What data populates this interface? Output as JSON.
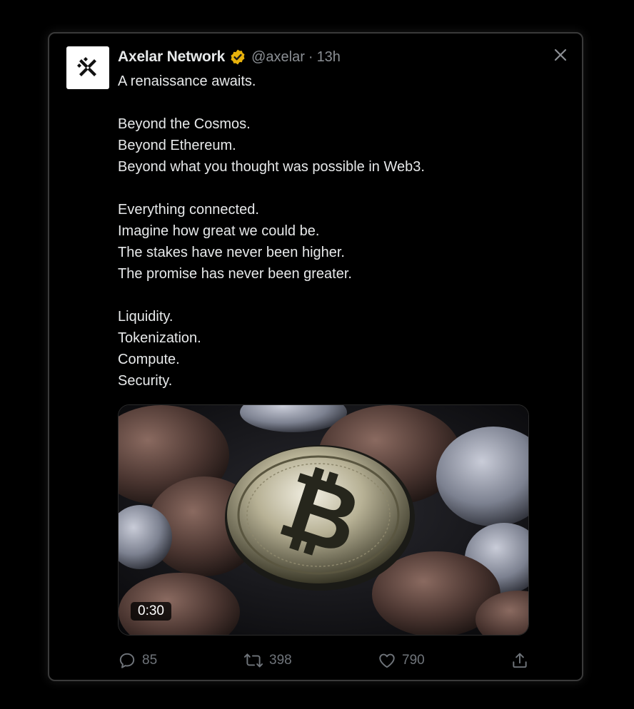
{
  "tweet": {
    "author_name": "Axelar Network",
    "handle": "@axelar",
    "separator": "·",
    "time": "13h",
    "verified_icon": "verified-badge-icon",
    "body_lines": [
      "A renaissance awaits.",
      "",
      "Beyond the Cosmos.",
      "Beyond Ethereum.",
      "Beyond what you thought was possible in Web3.",
      "",
      "Everything connected.",
      "Imagine how great we could be.",
      "The stakes have never been higher.",
      "The promise has never been greater.",
      "",
      "Liquidity.",
      "Tokenization.",
      "Compute.",
      "Security."
    ],
    "video": {
      "duration": "0:30"
    },
    "stats": {
      "replies": "85",
      "retweets": "398",
      "likes": "790"
    }
  },
  "colors": {
    "background": "#000000",
    "text": "#e7e9ea",
    "muted": "#8b8f94",
    "verified_gold": "#e8b20c"
  }
}
